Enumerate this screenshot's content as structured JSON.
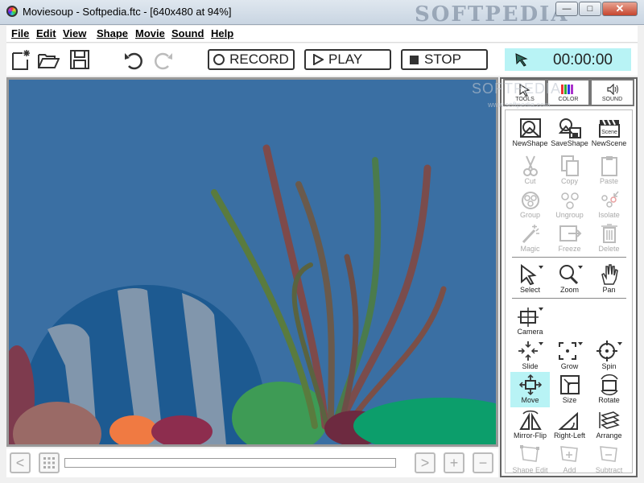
{
  "window": {
    "title": "Moviesoup - Softpedia.ftc - [640x480 at 94%]",
    "watermark": "SOFTPEDIA",
    "controls": {
      "minimize": "—",
      "maximize": "□",
      "close": "✕"
    }
  },
  "menu": [
    "File",
    "Edit",
    "View",
    "Shape",
    "Movie",
    "Sound",
    "Help"
  ],
  "toolbar": {
    "record_label": "RECORD",
    "play_label": "PLAY",
    "stop_label": "STOP",
    "timer": "00:00:00"
  },
  "panel": {
    "tabs": [
      {
        "label": "TOOLS",
        "icon": "pointer-icon"
      },
      {
        "label": "COLOR",
        "icon": "color-bars-icon"
      },
      {
        "label": "SOUND",
        "icon": "speaker-icon"
      }
    ],
    "watermark": "SOFTPEDIA",
    "watermark_url": "www.softpedia.com",
    "tools": [
      {
        "label": "NewShape",
        "icon": "new-shape-icon",
        "enabled": true
      },
      {
        "label": "SaveShape",
        "icon": "save-shape-icon",
        "enabled": true
      },
      {
        "label": "NewScene",
        "icon": "new-scene-icon",
        "enabled": true
      },
      {
        "label": "Cut",
        "icon": "scissors-icon",
        "enabled": false
      },
      {
        "label": "Copy",
        "icon": "copy-icon",
        "enabled": false
      },
      {
        "label": "Paste",
        "icon": "paste-icon",
        "enabled": false
      },
      {
        "label": "Group",
        "icon": "group-icon",
        "enabled": false
      },
      {
        "label": "Ungroup",
        "icon": "ungroup-icon",
        "enabled": false
      },
      {
        "label": "Isolate",
        "icon": "isolate-icon",
        "enabled": false
      },
      {
        "label": "Magic",
        "icon": "magic-wand-icon",
        "enabled": false
      },
      {
        "label": "Freeze",
        "icon": "freeze-icon",
        "enabled": false
      },
      {
        "label": "Delete",
        "icon": "trash-icon",
        "enabled": false
      },
      {
        "label": "Select",
        "icon": "select-arrow-icon",
        "enabled": true
      },
      {
        "label": "Zoom",
        "icon": "magnifier-icon",
        "enabled": true
      },
      {
        "label": "Pan",
        "icon": "hand-icon",
        "enabled": true
      },
      {
        "label": "Camera",
        "icon": "camera-icon",
        "enabled": true
      },
      {
        "label": "Slide",
        "icon": "slide-icon",
        "enabled": true
      },
      {
        "label": "Grow",
        "icon": "grow-icon",
        "enabled": true
      },
      {
        "label": "Spin",
        "icon": "spin-icon",
        "enabled": true
      },
      {
        "label": "Move",
        "icon": "move-icon",
        "enabled": true,
        "active": true
      },
      {
        "label": "Size",
        "icon": "size-icon",
        "enabled": true
      },
      {
        "label": "Rotate",
        "icon": "rotate-icon",
        "enabled": true
      },
      {
        "label": "Mirror-Flip",
        "icon": "mirror-flip-icon",
        "enabled": true
      },
      {
        "label": "Right-Left",
        "icon": "right-left-icon",
        "enabled": true
      },
      {
        "label": "Arrange",
        "icon": "arrange-icon",
        "enabled": true
      },
      {
        "label": "Shape Edit",
        "icon": "shape-edit-icon",
        "enabled": false
      },
      {
        "label": "Add",
        "icon": "add-point-icon",
        "enabled": false
      },
      {
        "label": "Subtract",
        "icon": "subtract-point-icon",
        "enabled": false
      }
    ]
  },
  "bottom": {
    "prev": "<",
    "next": ">",
    "add": "+",
    "remove": "−"
  },
  "colors": {
    "water": "#3a6fa3",
    "accent": "#b8f3f5"
  }
}
